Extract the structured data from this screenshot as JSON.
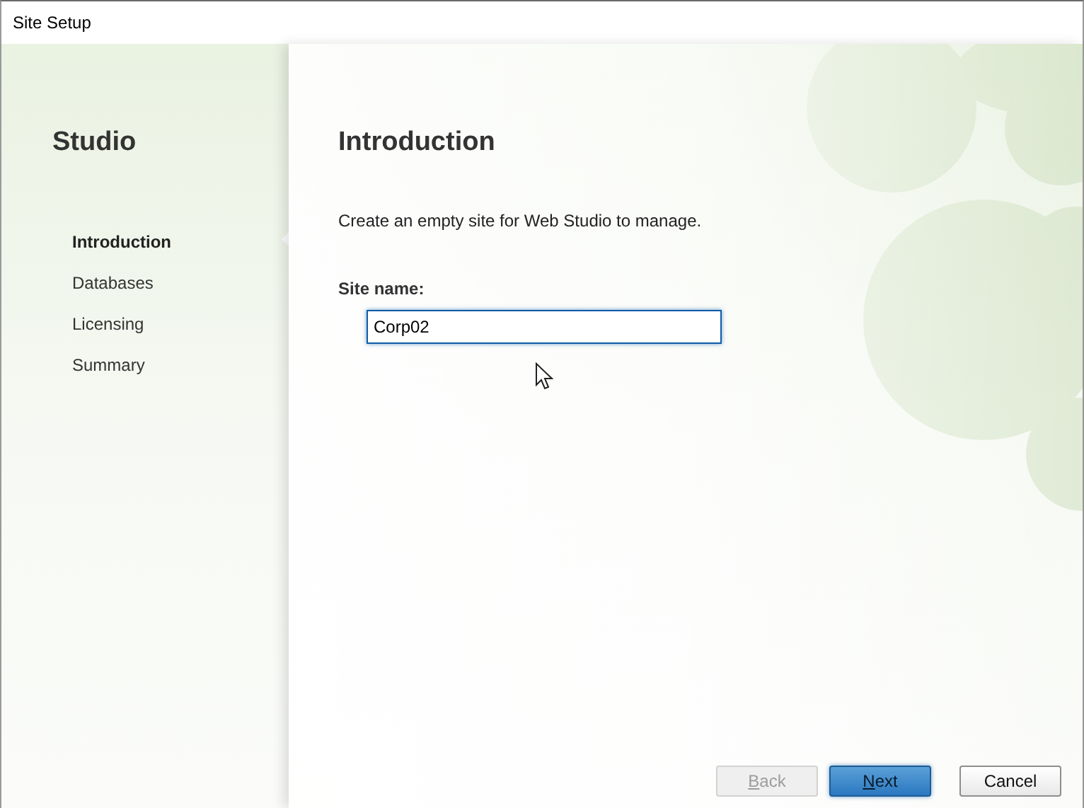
{
  "window": {
    "title": "Site Setup"
  },
  "sidebar": {
    "title": "Studio",
    "items": [
      {
        "label": "Introduction",
        "selected": true
      },
      {
        "label": "Databases",
        "selected": false
      },
      {
        "label": "Licensing",
        "selected": false
      },
      {
        "label": "Summary",
        "selected": false
      }
    ]
  },
  "page": {
    "heading": "Introduction",
    "description": "Create an empty site for Web Studio to manage.",
    "field": {
      "label": "Site name:",
      "value": "Corp02",
      "focused": true
    }
  },
  "buttons": [
    {
      "label": "Back",
      "mnemonic": true,
      "disabled": true,
      "default": false
    },
    {
      "label": "Next",
      "mnemonic": true,
      "disabled": false,
      "default": true
    },
    {
      "label": "Cancel",
      "mnemonic": false,
      "disabled": false,
      "default": false
    }
  ]
}
